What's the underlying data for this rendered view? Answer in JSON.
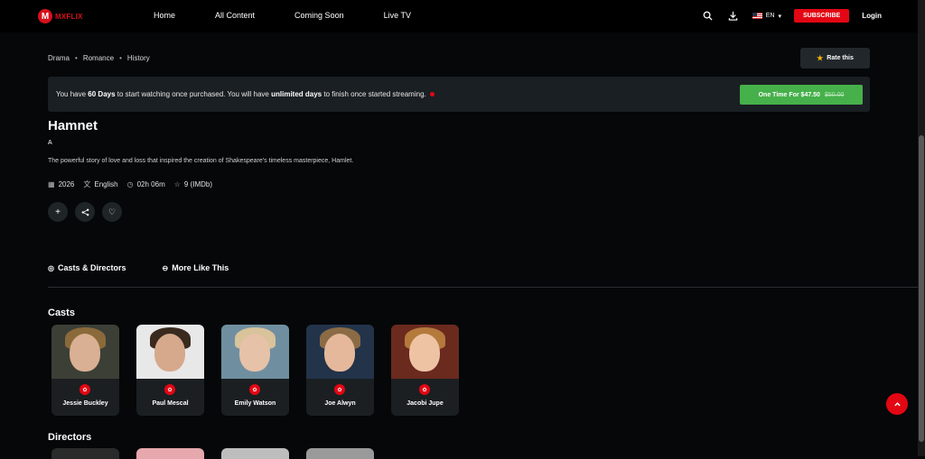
{
  "brand": {
    "name": "MXFLIX",
    "logo_letter": "M"
  },
  "nav": [
    "Home",
    "All Content",
    "Coming Soon",
    "Live TV"
  ],
  "header": {
    "lang": "EN",
    "subscribe": "SUBSCRIBE",
    "login": "Login"
  },
  "genres": [
    "Drama",
    "Romance",
    "History"
  ],
  "rate_label": "Rate this",
  "purchase": {
    "text_1": "You have ",
    "days": "60 Days",
    "text_2": " to start watching once purchased. You will have ",
    "unlimited": "unlimited days",
    "text_3": " to finish once started streaming.",
    "button": "One Time For $47.50",
    "old_price": "$50.00"
  },
  "movie": {
    "title": "Hamnet",
    "rating": "A",
    "description": "The powerful story of love and loss that inspired the creation of Shakespeare's timeless masterpiece, Hamlet.",
    "year": "2026",
    "language": "English",
    "duration": "02h 06m",
    "imdb": "9 (IMDb)"
  },
  "tabs": [
    "Casts & Directors",
    "More Like This"
  ],
  "sections": {
    "casts": "Casts",
    "directors": "Directors"
  },
  "casts": [
    {
      "name": "Jessie Buckley",
      "bg": "#3b3f36",
      "skin": "#d9b093",
      "hair": "#8a6a3a"
    },
    {
      "name": "Paul Mescal",
      "bg": "#e8e8e8",
      "skin": "#d6a98c",
      "hair": "#3a2a1e"
    },
    {
      "name": "Emily Watson",
      "bg": "#6f8fa0",
      "skin": "#e6c2a8",
      "hair": "#d8c39a"
    },
    {
      "name": "Joe Alwyn",
      "bg": "#22334a",
      "skin": "#e5b89b",
      "hair": "#8a6b45"
    },
    {
      "name": "Jacobi Jupe",
      "bg": "#6a2a1e",
      "skin": "#edc3a4",
      "hair": "#b47a3c"
    }
  ],
  "director_colors": [
    "#2a2a2a",
    "#e6a8ac",
    "#bdbdbd",
    "#9a9a9a"
  ]
}
